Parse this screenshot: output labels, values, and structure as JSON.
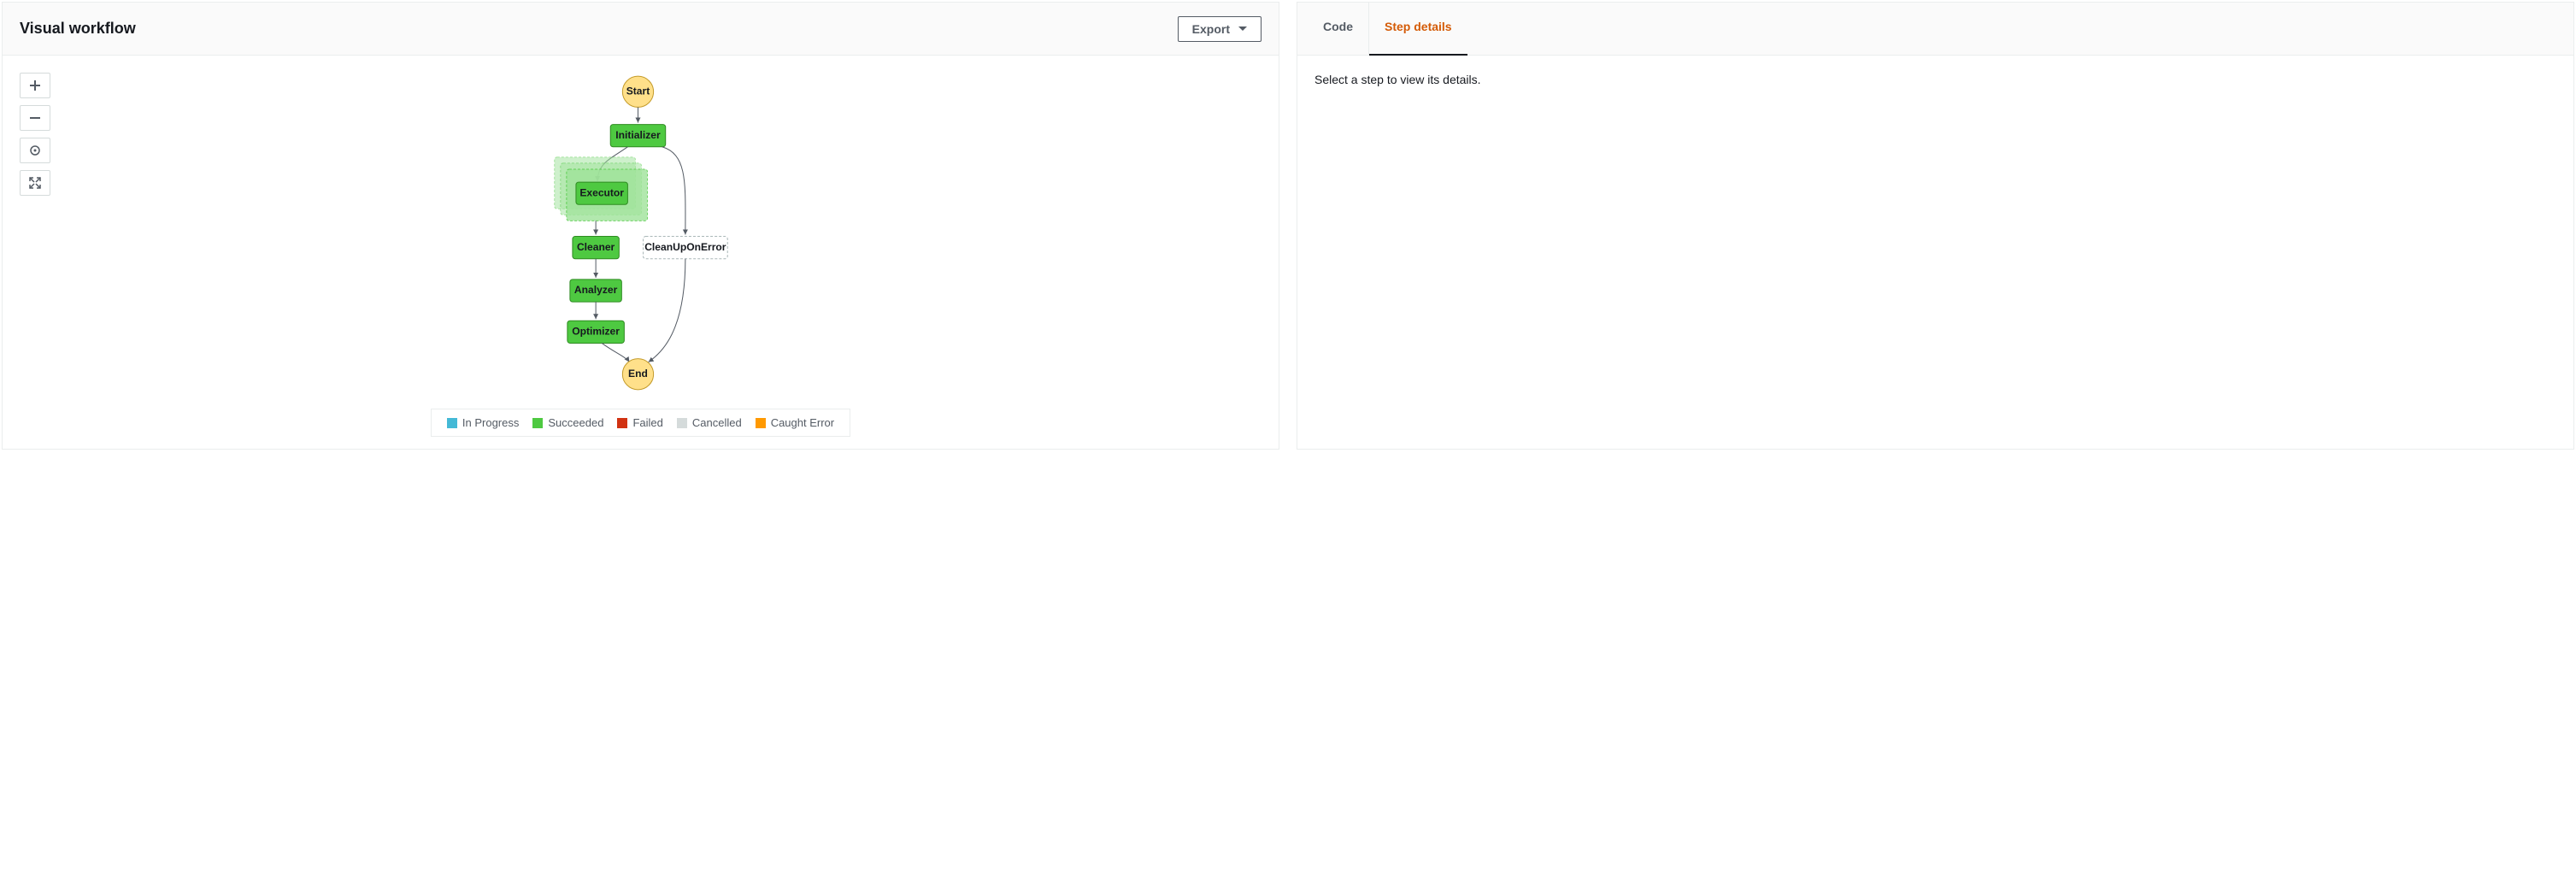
{
  "left": {
    "title": "Visual workflow",
    "export_label": "Export"
  },
  "nodes": {
    "start": "Start",
    "initializer": "Initializer",
    "executor": "Executor",
    "cleaner": "Cleaner",
    "cleanupOnError": "CleanUpOnError",
    "analyzer": "Analyzer",
    "optimizer": "Optimizer",
    "end": "End"
  },
  "legend": {
    "in_progress": {
      "label": "In Progress",
      "color": "#44b9d6"
    },
    "succeeded": {
      "label": "Succeeded",
      "color": "#4ec941"
    },
    "failed": {
      "label": "Failed",
      "color": "#d13212"
    },
    "cancelled": {
      "label": "Cancelled",
      "color": "#d5dbdb"
    },
    "caught": {
      "label": "Caught Error",
      "color": "#ff9900"
    }
  },
  "right": {
    "tabs": {
      "code": "Code",
      "details": "Step details"
    },
    "placeholder": "Select a step to view its details."
  }
}
